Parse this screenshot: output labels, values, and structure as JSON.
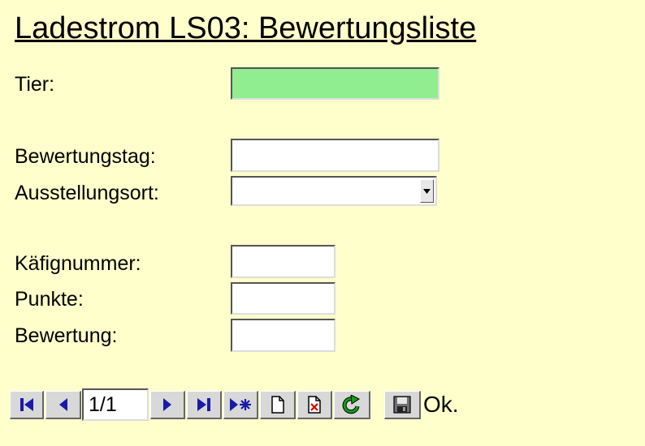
{
  "page": {
    "title": "Ladestrom LS03: Bewertungsliste"
  },
  "form": {
    "tier_label": "Tier:",
    "tier_value": "",
    "bewertungstag_label": "Bewertungstag:",
    "bewertungstag_value": "",
    "ausstellungsort_label": "Ausstellungsort:",
    "ausstellungsort_value": "",
    "kaefignummer_label": "Käfignummer:",
    "kaefignummer_value": "",
    "punkte_label": "Punkte:",
    "punkte_value": "",
    "bewertung_label": "Bewertung:",
    "bewertung_value": ""
  },
  "colors": {
    "background": "#ffffcc",
    "tier_field": "#90ee90",
    "nav_blue": "#1a1aa8"
  },
  "navigator": {
    "record_position": "1/1",
    "status_text": "Ok.",
    "icons": [
      "first-record-icon",
      "previous-record-icon",
      "next-record-icon",
      "last-record-icon",
      "new-record-icon",
      "new-document-icon",
      "delete-record-icon",
      "refresh-icon",
      "save-icon"
    ]
  }
}
